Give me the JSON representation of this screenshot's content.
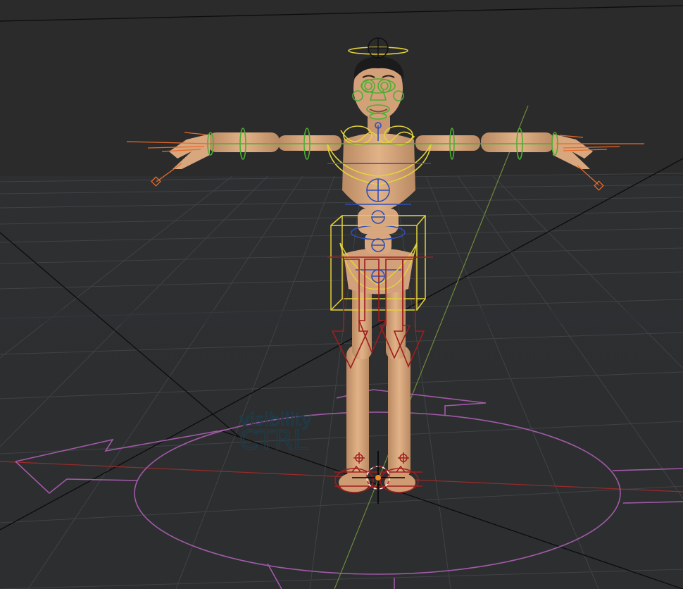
{
  "viewport": {
    "overlay_text": {
      "line1": "visibility",
      "line2": "CTRL"
    }
  },
  "colors": {
    "background": "#2b2b2b",
    "floor": "#303234",
    "grid": "#3d3f42",
    "axis_x": "#9b2b2b",
    "axis_y": "#6f8a3a",
    "skin": "#d9a57a",
    "skin_shade": "#b98a63",
    "ctrl_yellow": "#e2d23a",
    "ctrl_green": "#4caf32",
    "ctrl_blue": "#2f4fb8",
    "ctrl_red": "#a01d1d",
    "ctrl_orange": "#e86a2a",
    "ctrl_purple": "#a05aa6",
    "ctrl_text": "#1d3d4a"
  },
  "icons": [
    "3d-cursor-icon",
    "visibility-ctrl-label"
  ]
}
